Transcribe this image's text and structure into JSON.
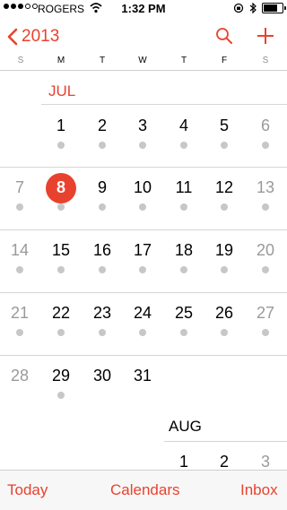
{
  "status": {
    "carrier": "ROGERS",
    "time": "1:32 PM",
    "battery_level": 0.75
  },
  "nav": {
    "back_label": "2013",
    "icons": [
      "chevron-left-icon",
      "search-icon",
      "plus-icon"
    ]
  },
  "weekdays": [
    "S",
    "M",
    "T",
    "W",
    "T",
    "F",
    "S"
  ],
  "months": [
    {
      "name": "JUL",
      "color": "#e8422e"
    },
    {
      "name": "AUG",
      "color": "#000000"
    }
  ],
  "july_weeks": [
    [
      "",
      "1",
      "2",
      "3",
      "4",
      "5",
      "6"
    ],
    [
      "7",
      "8",
      "9",
      "10",
      "11",
      "12",
      "13"
    ],
    [
      "14",
      "15",
      "16",
      "17",
      "18",
      "19",
      "20"
    ],
    [
      "21",
      "22",
      "23",
      "24",
      "25",
      "26",
      "27"
    ],
    [
      "28",
      "29",
      "30",
      "31",
      "",
      "",
      ""
    ]
  ],
  "selected_day": "8",
  "august_partial": [
    "1",
    "2",
    "3"
  ],
  "toolbar": {
    "today": "Today",
    "calendars": "Calendars",
    "inbox": "Inbox"
  },
  "colors": {
    "accent": "#e8422e",
    "weekend_text": "#9a9a9a",
    "event_dot": "#c7c7c7"
  }
}
